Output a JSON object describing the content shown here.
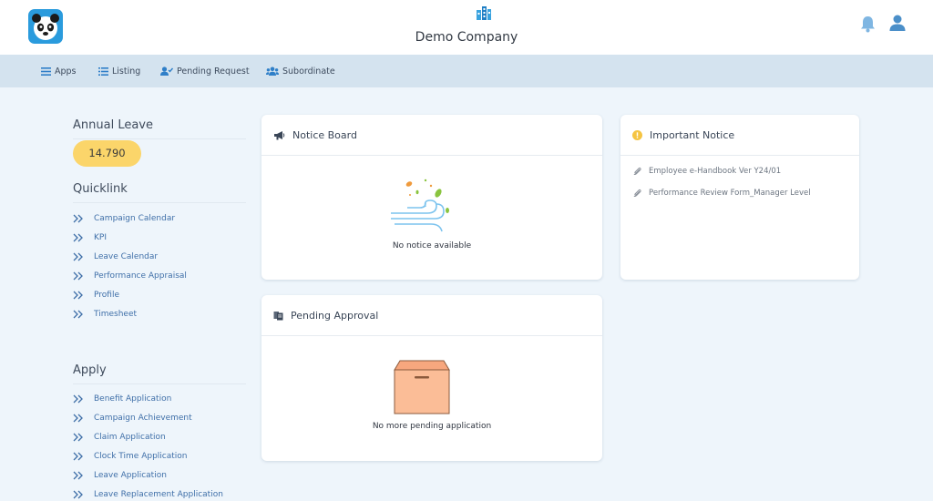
{
  "header": {
    "company_name": "Demo Company",
    "logo_icon": "panda-logo-icon",
    "notification_icon": "bell-icon",
    "profile_icon": "user-icon"
  },
  "nav": [
    {
      "label": "Apps",
      "icon": "menu-icon"
    },
    {
      "label": "Listing",
      "icon": "list-icon"
    },
    {
      "label": "Pending Request",
      "icon": "user-check-icon"
    },
    {
      "label": "Subordinate",
      "icon": "users-icon"
    }
  ],
  "annual_leave": {
    "title": "Annual Leave",
    "balance": "14.790"
  },
  "quicklink": {
    "title": "Quicklink",
    "items": [
      "Campaign Calendar",
      "KPI",
      "Leave Calendar",
      "Performance Appraisal",
      "Profile",
      "Timesheet"
    ]
  },
  "apply": {
    "title": "Apply",
    "items": [
      "Benefit Application",
      "Campaign Achievement",
      "Claim Application",
      "Clock Time Application",
      "Leave Application",
      "Leave Replacement Application"
    ]
  },
  "notice_board": {
    "title": "Notice Board",
    "empty_text": "No notice available"
  },
  "important_notice": {
    "title": "Important Notice",
    "items": [
      "Employee e-Handbook Ver Y24/01",
      "Performance Review Form_Manager Level"
    ]
  },
  "pending_approval": {
    "title": "Pending Approval",
    "empty_text": "No more pending application"
  },
  "colors": {
    "accent": "#2a9bdd",
    "navbar": "#d4e3ef",
    "leave_pill": "#fbd56a",
    "link": "#3f6fa8",
    "background": "#eef5fb"
  }
}
